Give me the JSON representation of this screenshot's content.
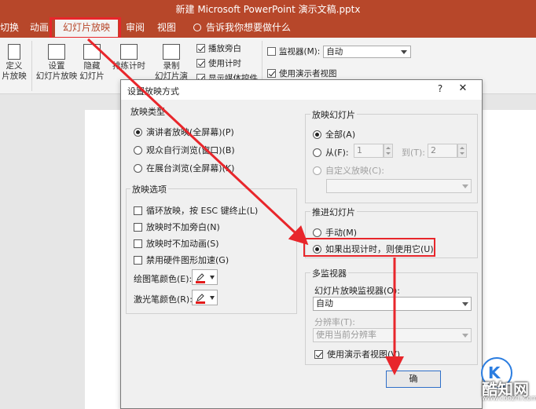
{
  "window": {
    "title": "新建 Microsoft PowerPoint 演示文稿.pptx"
  },
  "tabs": [
    {
      "label": "切换"
    },
    {
      "label": "动画"
    },
    {
      "label": "幻灯片放映"
    },
    {
      "label": "审阅"
    },
    {
      "label": "视图"
    }
  ],
  "tell_me": "告诉我你想要做什么",
  "ribbon": {
    "custom_show_line1": "定义",
    "custom_show_line2": "片放映",
    "setup_show_line1": "设置",
    "setup_show_line2": "幻灯片放映",
    "hide_slide_line1": "隐藏",
    "hide_slide_line2": "幻灯片",
    "rehearse": "排练计时",
    "record_line1": "录制",
    "record_line2": "幻灯片演示",
    "chk_play_narration": "播放旁白",
    "chk_use_timings": "使用计时",
    "chk_show_media": "显示媒体控件",
    "monitor_label": "监视器(M):",
    "monitor_value": "自动",
    "chk_presenter_view": "使用演示者视图"
  },
  "dialog": {
    "title": "设置放映方式",
    "help": "?",
    "close": "✕",
    "show_type": {
      "label": "放映类型",
      "options": [
        {
          "label": "演讲者放映(全屏幕)(P)",
          "selected": true
        },
        {
          "label": "观众自行浏览(窗口)(B)",
          "selected": false
        },
        {
          "label": "在展台浏览(全屏幕)(K)",
          "selected": false
        }
      ]
    },
    "show_options": {
      "label": "放映选项",
      "items": [
        {
          "label": "循环放映，按 ESC 键终止(L)",
          "checked": false
        },
        {
          "label": "放映时不加旁白(N)",
          "checked": false
        },
        {
          "label": "放映时不加动画(S)",
          "checked": false
        },
        {
          "label": "禁用硬件图形加速(G)",
          "checked": false
        }
      ],
      "pen_color_label": "绘图笔颜色(E):",
      "laser_color_label": "激光笔颜色(R):"
    },
    "show_slides": {
      "label": "放映幻灯片",
      "all": "全部(A)",
      "from": "从(F):",
      "from_value": "1",
      "to": "到(T):",
      "to_value": "2",
      "custom": "自定义放映(C):",
      "custom_value": ""
    },
    "advance": {
      "label": "推进幻灯片",
      "manual": "手动(M)",
      "use_timings": "如果出现计时，则使用它(U)"
    },
    "multi_monitor": {
      "label": "多监视器",
      "monitor_label": "幻灯片放映监视器(O):",
      "monitor_value": "自动",
      "resolution_label": "分辨率(T):",
      "resolution_value": "使用当前分辨率",
      "presenter_view": "使用演示者视图(V)"
    },
    "ok": "确"
  },
  "colors": {
    "accent": "#b7472a",
    "highlight": "#e8262b",
    "pen": "#e31b1b"
  },
  "watermark": {
    "logo": "K",
    "brand": "酷知网",
    "url": "www.coozhi.com"
  }
}
